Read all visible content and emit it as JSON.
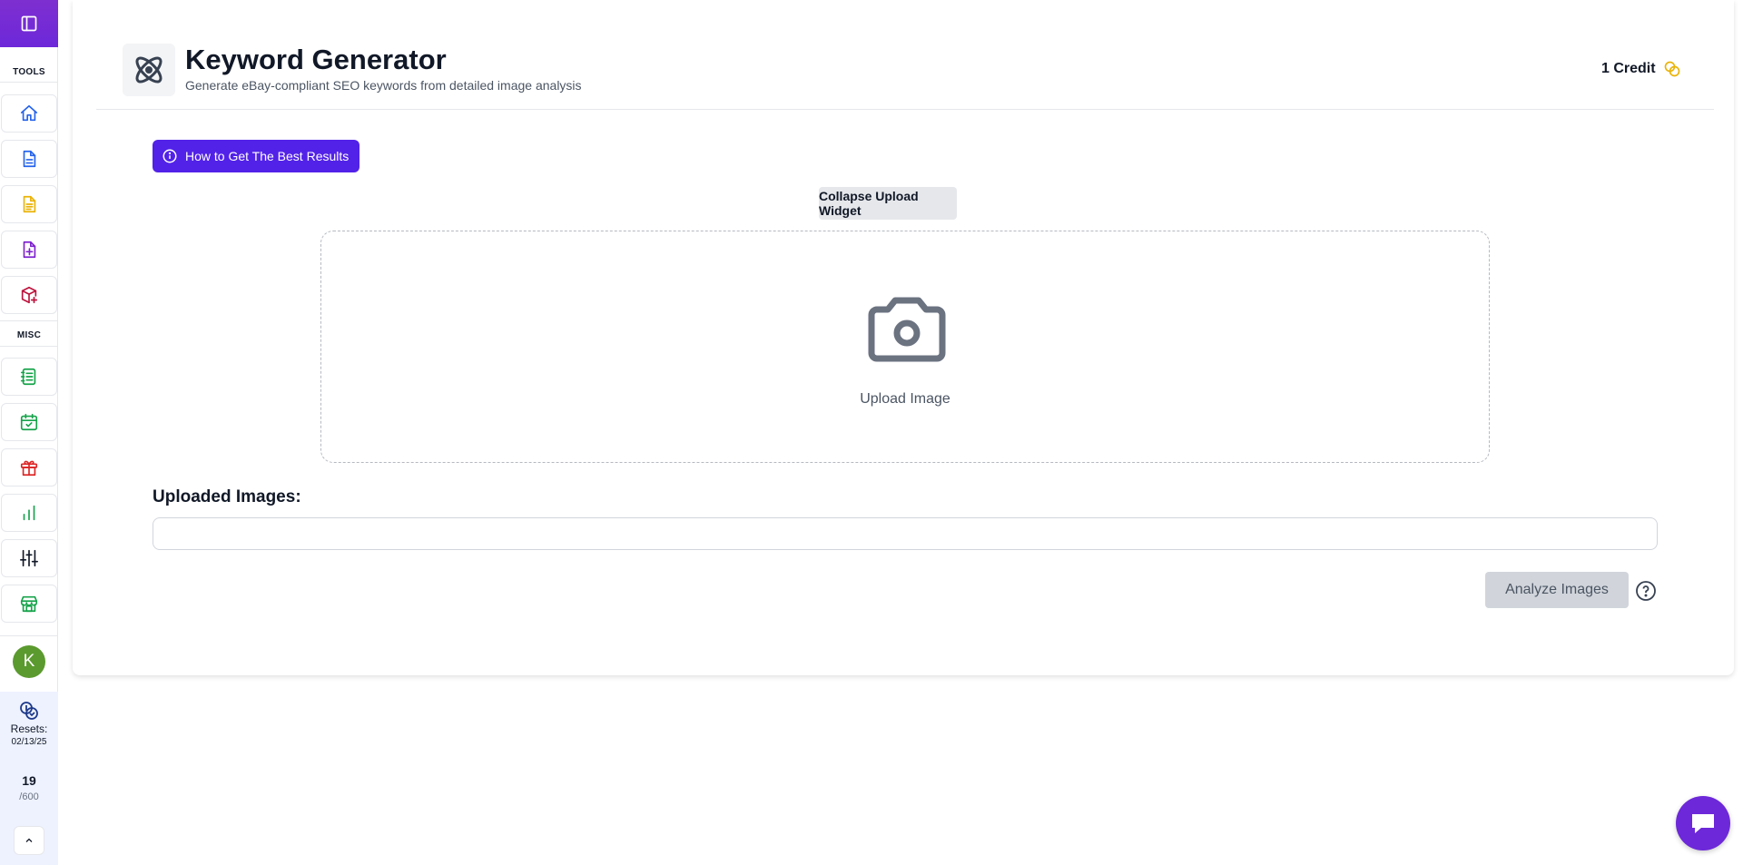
{
  "sidebar": {
    "section_tools": "TOOLS",
    "section_misc": "MISC",
    "tools": [
      {
        "icon": "home-icon",
        "color": "#2563eb"
      },
      {
        "icon": "document-icon",
        "color": "#2563eb"
      },
      {
        "icon": "document-text-icon",
        "color": "#eab308"
      },
      {
        "icon": "document-add-icon",
        "color": "#7e22ce"
      },
      {
        "icon": "package-add-icon",
        "color": "#be123c"
      }
    ],
    "misc": [
      {
        "icon": "notebook-icon",
        "color": "#16a34a"
      },
      {
        "icon": "calendar-check-icon",
        "color": "#16a34a"
      },
      {
        "icon": "gift-icon",
        "color": "#dc2626"
      },
      {
        "icon": "bar-chart-icon",
        "color": "#16a34a"
      },
      {
        "icon": "sliders-icon",
        "color": "#111827"
      },
      {
        "icon": "store-icon",
        "color": "#16a34a"
      }
    ],
    "avatar_initial": "K",
    "resets_label": "Resets:",
    "resets_date": "02/13/25",
    "usage_used": "19",
    "usage_total": "/600"
  },
  "header": {
    "title": "Keyword Generator",
    "subtitle": "Generate eBay-compliant SEO keywords from detailed image analysis",
    "credits": "1 Credit"
  },
  "main": {
    "tips_button": "How to Get The Best Results",
    "collapse_button": "Collapse Upload Widget",
    "upload_label": "Upload Image",
    "uploaded_title": "Uploaded Images:",
    "analyze_button": "Analyze Images"
  },
  "colors": {
    "brand_purple": "#6d28d9",
    "tips_button_bg": "#5222e8",
    "credit_icon": "#eab308",
    "avatar_bg": "#5b9a2e"
  }
}
